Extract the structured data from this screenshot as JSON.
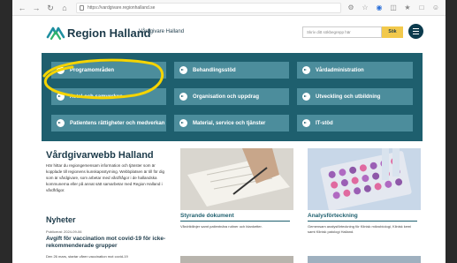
{
  "browser": {
    "url": "https://vardgivare.regionhalland.se"
  },
  "header": {
    "brand": "Region Halland",
    "brand_sub": "Vårdgivare Halland",
    "search_placeholder": "Skriv ditt sökbegrepp här",
    "search_button": "Sök"
  },
  "nav": {
    "items": [
      {
        "label": "Programområden"
      },
      {
        "label": "Behandlingsstöd"
      },
      {
        "label": "Vårdadministration"
      },
      {
        "label": "Avtal och samverkan"
      },
      {
        "label": "Organisation och uppdrag"
      },
      {
        "label": "Utveckling och utbildning"
      },
      {
        "label": "Patientens rättigheter och medverkan"
      },
      {
        "label": "Material, service och tjänster"
      },
      {
        "label": "IT-stöd"
      }
    ]
  },
  "main": {
    "title": "Vårdgivarwebb Halland",
    "intro": "Här hittar du regiongemensam information och tjänster som är kopplade till regionens kunskapsstyrning. Webbplatsen är till för dig som är vårdgivare, som arbetar med vårdfrågor i de hallandska kommunerna eller på annat sätt samarbetar med Region Halland i vårdfrågor.",
    "news_heading": "Nyheter",
    "news_date": "Publicerat: 2024-09-06",
    "news_title": "Avgift för vaccination mot covid-19 för icke-rekommenderade grupper",
    "news_text": "Den 26 mars, startar våren vaccination mot covid-19"
  },
  "cards": [
    {
      "title": "Styrande dokument",
      "text": "Vårdriktlinjer samt patientnära rutiner och blanketter."
    },
    {
      "title": "Analysförteckning",
      "text": "Gemensam analysförteckning för Klinisk mikrobiologi, Klinisk kemi samt Klinisk patologi Halland."
    }
  ],
  "colors": {
    "teal_panel": "#1e5f6e",
    "teal_button": "#4c8d9c",
    "search_button": "#f2c94c",
    "highlight": "#f5d400"
  }
}
